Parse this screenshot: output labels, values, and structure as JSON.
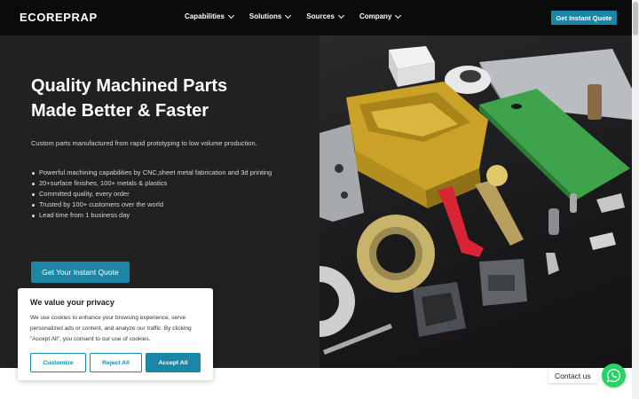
{
  "brand": {
    "logo": "ECOREPRAP",
    "accent": "#1b86a5"
  },
  "nav": {
    "items": [
      {
        "label": "Capabilities"
      },
      {
        "label": "Solutions"
      },
      {
        "label": "Sources"
      },
      {
        "label": "Company"
      }
    ],
    "cta_label": "Get Instant Quote"
  },
  "hero": {
    "headline_line1": "Quality Machined Parts",
    "headline_line2": "Made Better & Faster",
    "subhead": "Custom parts manufactured from rapid prototyping to low volume production.",
    "bullets": [
      "Powerful machining capabilities by CNC,sheet metal fabrication and 3d printing",
      "20+surface finishes, 100+ metals & plastics",
      "Committed quality, every order",
      "Trusted by 100+ customers over the world",
      "Lead time from 1 business day"
    ],
    "cta_label": "Get Your Instant Quote"
  },
  "cookie": {
    "title": "We value your privacy",
    "text": "We use cookies to enhance your browsing experience, serve personalized ads or content, and analyze our traffic. By clicking \"Accept All\", you consent to our use of cookies.",
    "customize_label": "Customize",
    "reject_label": "Reject All",
    "accept_label": "Accept All"
  },
  "contact": {
    "label": "Contact us",
    "icon": "whatsapp-icon"
  }
}
